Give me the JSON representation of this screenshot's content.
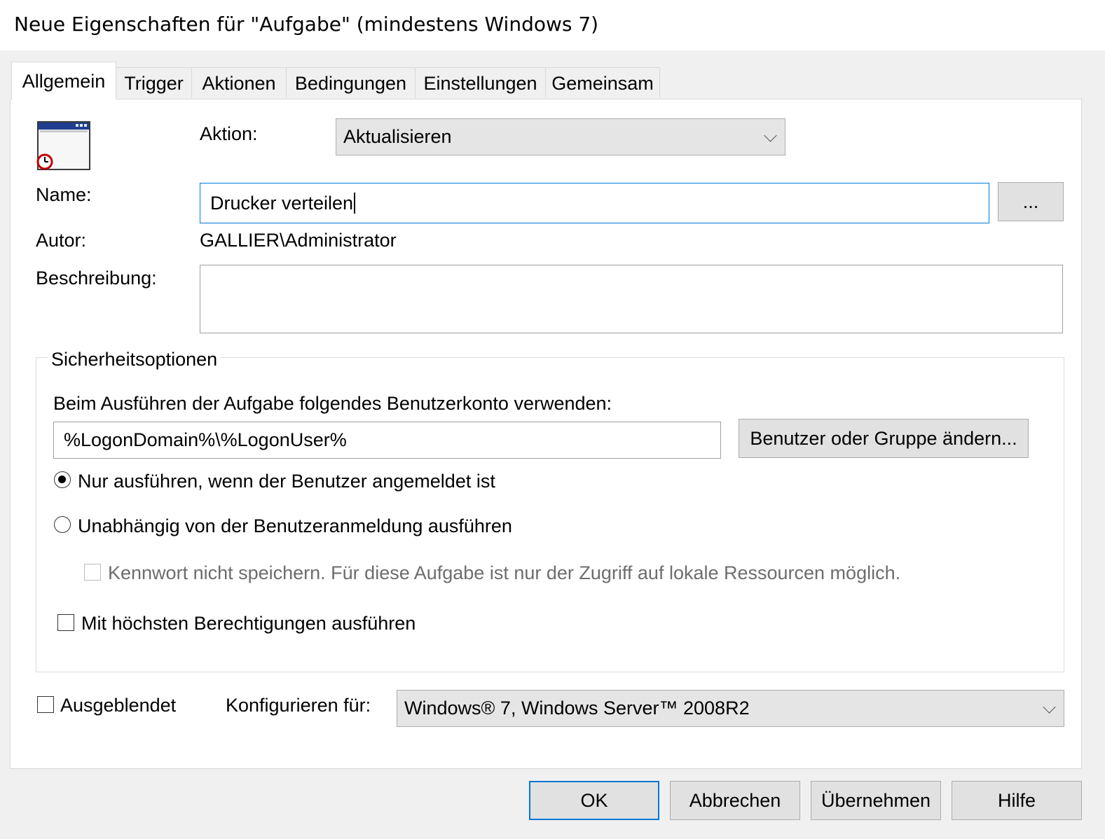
{
  "window": {
    "title": "Neue Eigenschaften für \"Aufgabe\" (mindestens Windows 7)"
  },
  "tabs": [
    {
      "label": "Allgemein",
      "active": true
    },
    {
      "label": "Trigger"
    },
    {
      "label": "Aktionen"
    },
    {
      "label": "Bedingungen"
    },
    {
      "label": "Einstellungen"
    },
    {
      "label": "Gemeinsam"
    }
  ],
  "general": {
    "icon": "scheduled-task-window-icon",
    "action_label": "Aktion:",
    "action_value": "Aktualisieren",
    "name_label": "Name:",
    "name_value": "Drucker verteilen",
    "browse_label": "...",
    "author_label": "Autor:",
    "author_value": "GALLIER\\Administrator",
    "description_label": "Beschreibung:",
    "description_value": ""
  },
  "security": {
    "group_title": "Sicherheitsoptionen",
    "account_prompt": "Beim Ausführen der Aufgabe folgendes Benutzerkonto verwenden:",
    "account_value": "%LogonDomain%\\%LogonUser%",
    "change_user_label": "Benutzer oder Gruppe ändern...",
    "radio_logged_on": "Nur ausführen, wenn der Benutzer angemeldet ist",
    "radio_independent": "Unabhängig von der Benutzeranmeldung ausführen",
    "dont_store_password": "Kennwort nicht speichern. Für diese Aufgabe ist nur der Zugriff auf lokale Ressourcen möglich.",
    "highest_privileges": "Mit höchsten Berechtigungen ausführen",
    "selected_radio": "logged_on"
  },
  "bottom": {
    "hidden_label": "Ausgeblendet",
    "configure_label": "Konfigurieren für:",
    "configure_value": "Windows® 7, Windows Server™ 2008R2"
  },
  "buttons": {
    "ok": "OK",
    "cancel": "Abbrechen",
    "apply": "Übernehmen",
    "help": "Hilfe"
  },
  "colors": {
    "accent": "#0078d7",
    "dialog_bg": "#f0f0f0",
    "panel_bg": "#ffffff"
  }
}
